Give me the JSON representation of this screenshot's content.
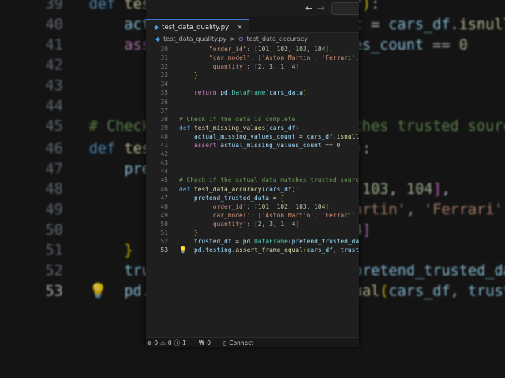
{
  "tab": {
    "filename": "test_data_quality.py",
    "close": "×"
  },
  "breadcrumb": {
    "file": "test_data_quality.py",
    "separator": ">",
    "symbol": "test_data_accuracy"
  },
  "nav": {
    "back": "←",
    "forward": "→"
  },
  "icons": {
    "file": "python-file-icon",
    "symbol": "method-icon",
    "bulb": "lightbulb-icon"
  },
  "current_line": 53,
  "lines": [
    {
      "n": 30,
      "t": [
        [
          "op",
          "        "
        ],
        [
          "str",
          "\"order_id\""
        ],
        [
          "op",
          ": "
        ],
        [
          "p2",
          "["
        ],
        [
          "num",
          "101"
        ],
        [
          "op",
          ", "
        ],
        [
          "num",
          "102"
        ],
        [
          "op",
          ", "
        ],
        [
          "num",
          "103"
        ],
        [
          "op",
          ", "
        ],
        [
          "num",
          "104"
        ],
        [
          "p2",
          "]"
        ],
        [
          "op",
          ","
        ]
      ]
    },
    {
      "n": 31,
      "t": [
        [
          "op",
          "        "
        ],
        [
          "str",
          "\"car_model\""
        ],
        [
          "op",
          ": "
        ],
        [
          "p2",
          "["
        ],
        [
          "str",
          "'Aston Martin'"
        ],
        [
          "op",
          ", "
        ],
        [
          "str",
          "'Ferrari'"
        ],
        [
          "op",
          ", "
        ],
        [
          "str",
          "'"
        ]
      ]
    },
    {
      "n": 32,
      "t": [
        [
          "op",
          "        "
        ],
        [
          "str",
          "'quantity'"
        ],
        [
          "op",
          ": "
        ],
        [
          "p2",
          "["
        ],
        [
          "num",
          "2"
        ],
        [
          "op",
          ", "
        ],
        [
          "num",
          "3"
        ],
        [
          "op",
          ", "
        ],
        [
          "num",
          "1"
        ],
        [
          "op",
          ", "
        ],
        [
          "num",
          "4"
        ],
        [
          "p2",
          "]"
        ]
      ]
    },
    {
      "n": 33,
      "t": [
        [
          "op",
          "    "
        ],
        [
          "p1",
          "}"
        ]
      ]
    },
    {
      "n": 34,
      "t": []
    },
    {
      "n": 35,
      "t": [
        [
          "op",
          "    "
        ],
        [
          "ctl",
          "return"
        ],
        [
          "op",
          " "
        ],
        [
          "var",
          "pd"
        ],
        [
          "op",
          "."
        ],
        [
          "cls",
          "DataFrame"
        ],
        [
          "p1",
          "("
        ],
        [
          "var",
          "cars_data"
        ],
        [
          "p1",
          ")"
        ]
      ]
    },
    {
      "n": 36,
      "t": []
    },
    {
      "n": 37,
      "t": []
    },
    {
      "n": 38,
      "t": [
        [
          "com",
          "# Check if the data is complete"
        ]
      ]
    },
    {
      "n": 39,
      "t": [
        [
          "kw",
          "def"
        ],
        [
          "op",
          " "
        ],
        [
          "fn",
          "test_missing_values"
        ],
        [
          "p1",
          "("
        ],
        [
          "var",
          "cars_df"
        ],
        [
          "p1",
          ")"
        ],
        [
          "op",
          ":"
        ]
      ]
    },
    {
      "n": 40,
      "t": [
        [
          "op",
          "    "
        ],
        [
          "var",
          "actual_missing_values_count"
        ],
        [
          "op",
          " = "
        ],
        [
          "var",
          "cars_df"
        ],
        [
          "op",
          "."
        ],
        [
          "fn",
          "isnull"
        ],
        [
          "p1",
          "()"
        ]
      ]
    },
    {
      "n": 41,
      "t": [
        [
          "op",
          "    "
        ],
        [
          "ctl",
          "assert"
        ],
        [
          "op",
          " "
        ],
        [
          "var",
          "actual_missing_values_count"
        ],
        [
          "op",
          " == "
        ],
        [
          "num",
          "0"
        ]
      ]
    },
    {
      "n": 42,
      "t": []
    },
    {
      "n": 43,
      "t": []
    },
    {
      "n": 44,
      "t": []
    },
    {
      "n": 45,
      "t": [
        [
          "com",
          "# Check if the actual data matches trusted sources"
        ]
      ]
    },
    {
      "n": 46,
      "t": [
        [
          "kw",
          "def"
        ],
        [
          "op",
          " "
        ],
        [
          "fn",
          "test_data_accuracy"
        ],
        [
          "p1",
          "("
        ],
        [
          "var",
          "cars_df"
        ],
        [
          "p1",
          ")"
        ],
        [
          "op",
          ":"
        ]
      ]
    },
    {
      "n": 47,
      "t": [
        [
          "op",
          "    "
        ],
        [
          "var",
          "pretend_trusted_data"
        ],
        [
          "op",
          " = "
        ],
        [
          "p1",
          "{"
        ]
      ]
    },
    {
      "n": 48,
      "t": [
        [
          "op",
          "        "
        ],
        [
          "str",
          "'order_id'"
        ],
        [
          "op",
          ": "
        ],
        [
          "p2",
          "["
        ],
        [
          "num",
          "101"
        ],
        [
          "op",
          ", "
        ],
        [
          "num",
          "102"
        ],
        [
          "op",
          ", "
        ],
        [
          "num",
          "103"
        ],
        [
          "op",
          ", "
        ],
        [
          "num",
          "104"
        ],
        [
          "p2",
          "]"
        ],
        [
          "op",
          ","
        ]
      ]
    },
    {
      "n": 49,
      "t": [
        [
          "op",
          "        "
        ],
        [
          "str",
          "'car_model'"
        ],
        [
          "op",
          ": "
        ],
        [
          "p2",
          "["
        ],
        [
          "str",
          "'Aston Martin'"
        ],
        [
          "op",
          ", "
        ],
        [
          "str",
          "'Ferrari'"
        ],
        [
          "op",
          ", "
        ],
        [
          "str",
          "'"
        ]
      ]
    },
    {
      "n": 50,
      "t": [
        [
          "op",
          "        "
        ],
        [
          "str",
          "'quantity'"
        ],
        [
          "op",
          ": "
        ],
        [
          "p2",
          "["
        ],
        [
          "num",
          "2"
        ],
        [
          "op",
          ", "
        ],
        [
          "num",
          "3"
        ],
        [
          "op",
          ", "
        ],
        [
          "num",
          "1"
        ],
        [
          "op",
          ", "
        ],
        [
          "num",
          "4"
        ],
        [
          "p2",
          "]"
        ]
      ]
    },
    {
      "n": 51,
      "t": [
        [
          "op",
          "    "
        ],
        [
          "p1",
          "}"
        ]
      ]
    },
    {
      "n": 52,
      "t": [
        [
          "op",
          "    "
        ],
        [
          "var",
          "trusted_df"
        ],
        [
          "op",
          " = "
        ],
        [
          "var",
          "pd"
        ],
        [
          "op",
          "."
        ],
        [
          "cls",
          "DataFrame"
        ],
        [
          "p1",
          "("
        ],
        [
          "var",
          "pretend_trusted_data"
        ]
      ]
    },
    {
      "n": 53,
      "t": [
        [
          "op",
          "    "
        ],
        [
          "var",
          "pd"
        ],
        [
          "op",
          "."
        ],
        [
          "var",
          "testing"
        ],
        [
          "op",
          "."
        ],
        [
          "fn",
          "assert_frame_equal"
        ],
        [
          "p1",
          "("
        ],
        [
          "var",
          "cars_df"
        ],
        [
          "op",
          ", "
        ],
        [
          "var",
          "trusted_"
        ]
      ]
    }
  ],
  "status": {
    "errors": "0",
    "warnings": "0",
    "info": "1",
    "ports": "0",
    "connect": "Connect",
    "error_icon": "⊗",
    "warning_icon": "⚠",
    "info_icon": "ⓘ",
    "ports_icon": "₩",
    "db_icon": "▯"
  }
}
